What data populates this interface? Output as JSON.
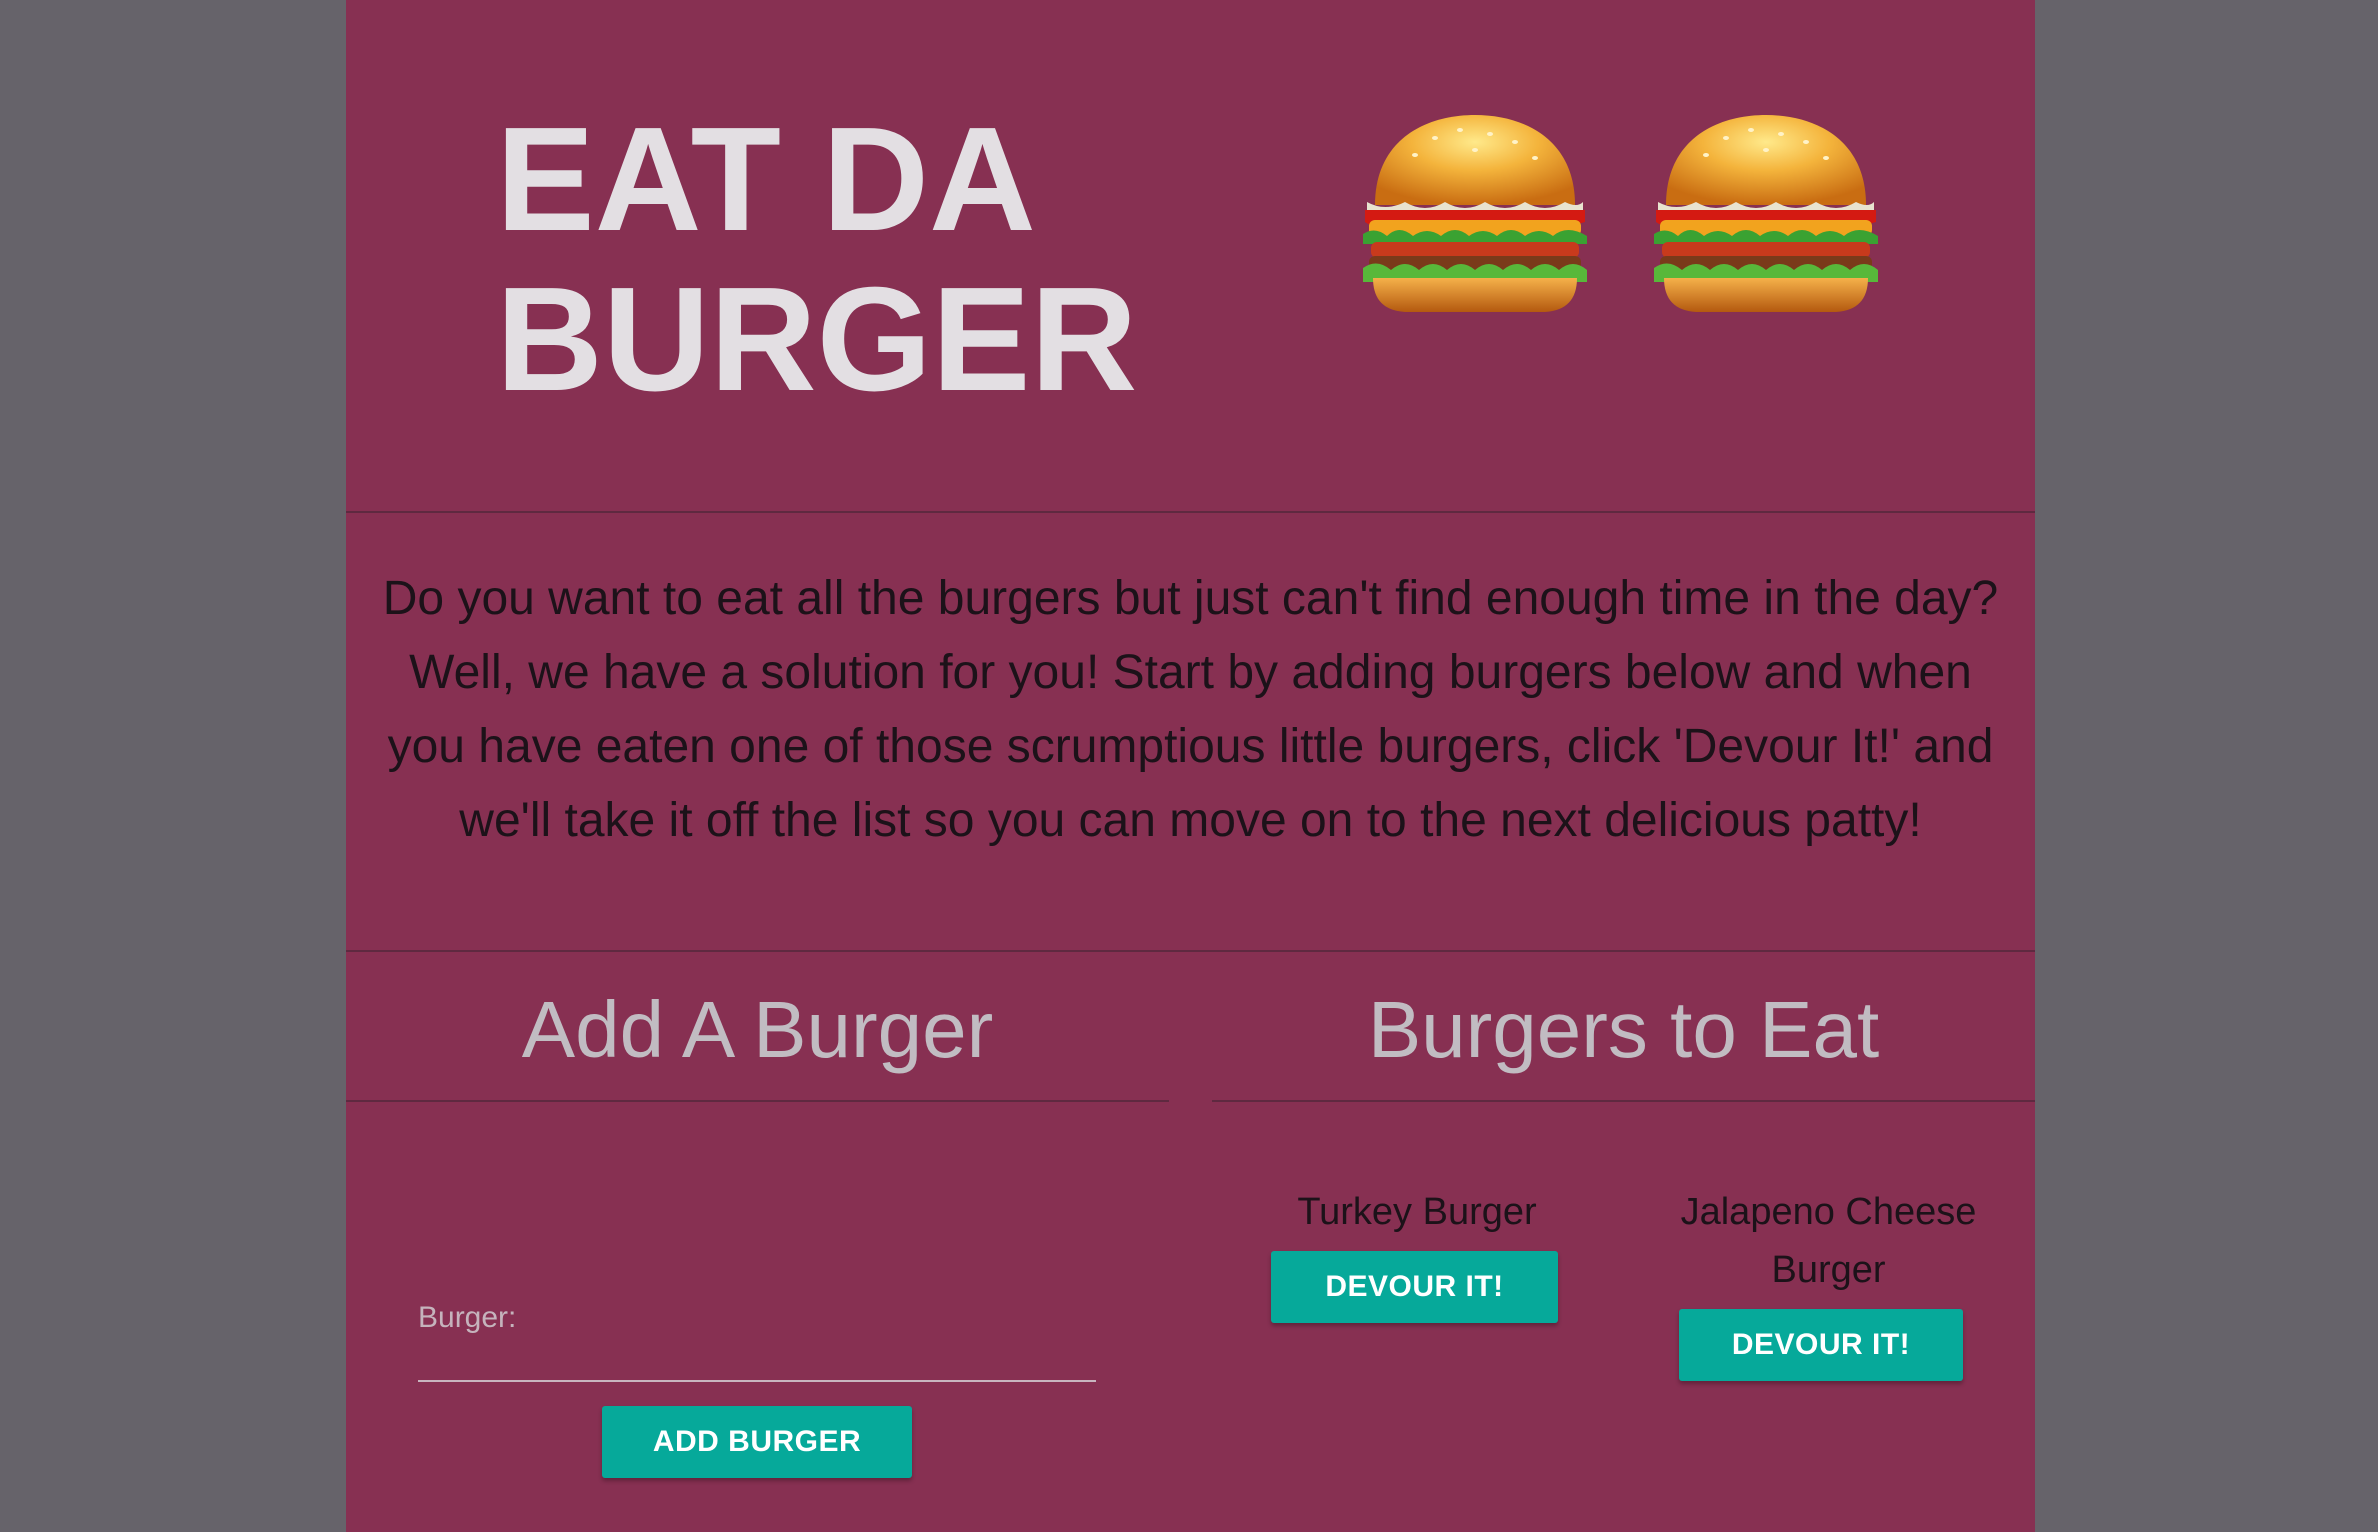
{
  "header": {
    "title_lines": [
      "EAT DA",
      "BURGER"
    ],
    "burger_icons": [
      "hamburger-icon",
      "hamburger-icon"
    ]
  },
  "intro": {
    "lines": [
      "Do you want to eat all the burgers but just can't find enough time in the day?",
      "Well, we have a solution for you! Start by adding burgers below and when",
      "you have eaten one of those scrumptious little burgers, click 'Devour It!' and",
      "we'll take it off the list so you can move on to the next delicious patty!"
    ]
  },
  "add_section": {
    "heading": "Add A Burger",
    "field_label": "Burger:",
    "field_value": "",
    "button_label": "ADD BURGER"
  },
  "eat_section": {
    "heading": "Burgers to Eat",
    "burgers": [
      {
        "name_lines": [
          "Turkey Burger"
        ],
        "button_label": "DEVOUR IT!"
      },
      {
        "name_lines": [
          "Jalapeno Cheese",
          "Burger"
        ],
        "button_label": "DEVOUR IT!"
      }
    ]
  },
  "colors": {
    "page_background": "#66636a",
    "panel": "#873052",
    "accent_button": "#06a99a",
    "title_text": "#e3dfe3"
  }
}
